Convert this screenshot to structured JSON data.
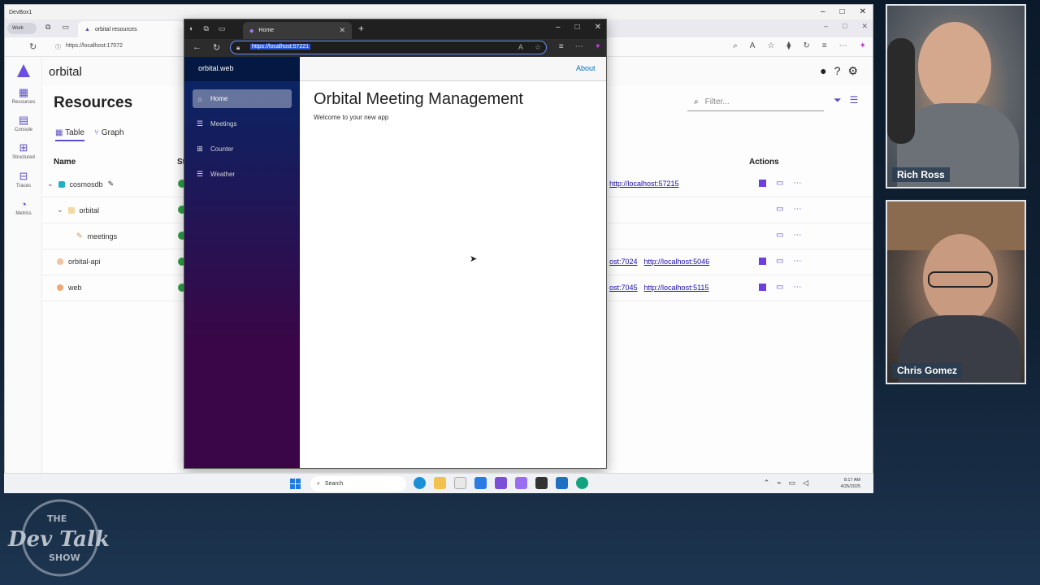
{
  "remote_window": {
    "title": "DevBox1"
  },
  "bg_browser": {
    "profile_label": "Work",
    "tab_title": "orbital resources",
    "url": "https://localhost:17072"
  },
  "dashboard": {
    "app_name": "orbital",
    "nav": [
      {
        "label": "Resources",
        "icon": "resources-icon"
      },
      {
        "label": "Console",
        "icon": "console-icon"
      },
      {
        "label": "Structured",
        "icon": "structured-logs-icon"
      },
      {
        "label": "Traces",
        "icon": "traces-icon"
      },
      {
        "label": "Metrics",
        "icon": "metrics-icon"
      }
    ],
    "title": "Resources",
    "view_tabs": {
      "table": "Table",
      "graph": "Graph"
    },
    "filter_placeholder": "Filter...",
    "columns": {
      "name": "Name",
      "state": "St",
      "actions": "Actions"
    },
    "rows": [
      {
        "name": "cosmosdb",
        "endpoints": [
          "http://localhost:57215"
        ]
      },
      {
        "name": "orbital",
        "endpoints": []
      },
      {
        "name": "meetings",
        "endpoints": []
      },
      {
        "name": "orbital-api",
        "endpoints": [
          "ost:7024",
          "http://localhost:5046"
        ]
      },
      {
        "name": "web",
        "endpoints": [
          "ost:7045",
          "http://localhost:5115"
        ]
      }
    ]
  },
  "fg_browser": {
    "tab_title": "Home",
    "url": "https://localhost:57221",
    "brand": "orbital.web",
    "nav": [
      {
        "label": "Home",
        "icon": "home-icon"
      },
      {
        "label": "Meetings",
        "icon": "list-icon"
      },
      {
        "label": "Counter",
        "icon": "plus-icon"
      },
      {
        "label": "Weather",
        "icon": "list-icon"
      }
    ],
    "about_link": "About",
    "heading": "Orbital Meeting Management",
    "welcome": "Welcome to your new app"
  },
  "taskbar": {
    "search_label": "Search",
    "time": "8:17 AM",
    "date": "4/25/2025"
  },
  "webcams": [
    {
      "name": "Rich Ross"
    },
    {
      "name": "Chris Gomez"
    }
  ],
  "logo": {
    "line1": "THE",
    "line2": "Dev Talk",
    "line3": "SHOW"
  },
  "colors": {
    "accent": "#5b4fc7",
    "link": "#1a0dab",
    "running": "#2f9e44",
    "sidebar_top": "#052767",
    "sidebar_bottom": "#3a0647"
  }
}
